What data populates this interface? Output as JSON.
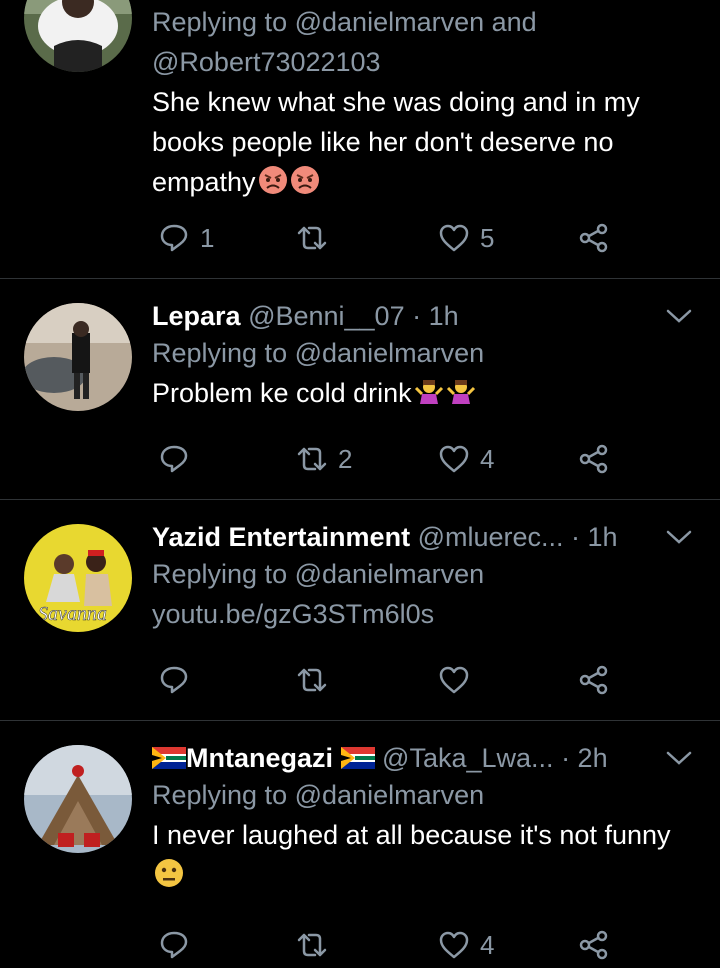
{
  "tweets": [
    {
      "name": "",
      "handle": "",
      "time": "",
      "reply_prefix": "Replying to",
      "reply_mentions": "@danielmarven and @Robert73022103",
      "text": "She knew what she was doing and in my books people like her don't deserve no empathy",
      "emoji": [
        "angry-face",
        "angry-face"
      ],
      "replies": "1",
      "retweets": "",
      "likes": "5"
    },
    {
      "name": "Lepara",
      "handle": "@Benni__07",
      "time": "· 1h",
      "reply_prefix": "Replying to",
      "reply_mentions": "@danielmarven",
      "text": "Problem ke cold drink",
      "emoji": [
        "shrug",
        "shrug"
      ],
      "replies": "",
      "retweets": "2",
      "likes": "4"
    },
    {
      "name": "Yazid Entertainment",
      "handle": "@mluerec...",
      "time": "· 1h",
      "reply_prefix": "Replying to",
      "reply_mentions": "@danielmarven",
      "text": "youtu.be/gzG3STm6l0s",
      "replies": "",
      "retweets": "",
      "likes": ""
    },
    {
      "name": "Mntanegazi",
      "handle": "@Taka_Lwa...",
      "time": "· 2h",
      "reply_prefix": "Replying to",
      "reply_mentions": "@danielmarven",
      "text": "I never laughed at all because it's not funny",
      "emoji": [
        "neutral-face"
      ],
      "replies": "",
      "retweets": "",
      "likes": "4"
    }
  ],
  "colors": {
    "background": "#000000",
    "text": "#ffffff",
    "secondary": "#8b98a5",
    "divider": "#2f3336"
  },
  "icons": [
    "reply-icon",
    "retweet-icon",
    "like-icon",
    "share-icon",
    "chevron-down-icon"
  ]
}
